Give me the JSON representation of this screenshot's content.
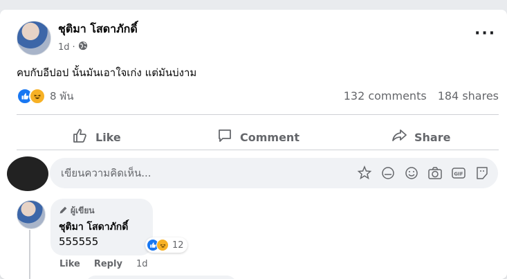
{
  "post": {
    "author": "ชุติมา โสดาภักดิ์",
    "time": "1d",
    "text": "คบกับอีปอป นั้นมันเอาใจเก่ง แต่มันบ่งาม",
    "reactions_count": "8 พัน",
    "comments_count": "132 comments",
    "shares_count": "184 shares",
    "icons": [
      "globe-icon",
      "more-options-icon",
      "like-reaction-icon",
      "haha-reaction-icon"
    ]
  },
  "actions": {
    "like": "Like",
    "comment": "Comment",
    "share": "Share"
  },
  "composer": {
    "placeholder": "เขียนความคิดเห็น..."
  },
  "comment": {
    "badge": "ผู้เขียน",
    "author": "ชุติมา โสดาภักดิ์",
    "text": "555555",
    "reactions_count": "12",
    "like_label": "Like",
    "reply_label": "Reply",
    "time": "1d"
  },
  "colors": {
    "like_blue": "#1877f2",
    "haha_yellow": "#f7b125",
    "secondary_text": "#65676b"
  }
}
